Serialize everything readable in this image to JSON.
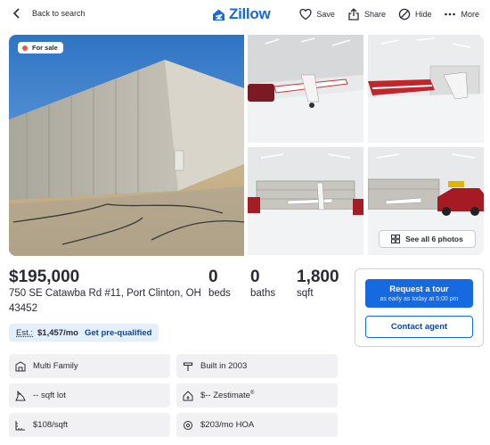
{
  "header": {
    "back_label": "Back to search",
    "logo_text": "Zillow",
    "actions": [
      {
        "label": "Save",
        "icon": "heart-icon"
      },
      {
        "label": "Share",
        "icon": "share-icon"
      },
      {
        "label": "Hide",
        "icon": "hide-icon"
      },
      {
        "label": "More",
        "icon": "more-icon"
      }
    ]
  },
  "gallery": {
    "status_badge": "For sale",
    "see_all_label": "See all 6 photos"
  },
  "listing": {
    "price": "$195,000",
    "address": "750 SE Catawba Rd #11, Port Clinton, OH 43452",
    "beds": "0",
    "beds_label": "beds",
    "baths": "0",
    "baths_label": "baths",
    "sqft": "1,800",
    "sqft_label": "sqft"
  },
  "estimate": {
    "label": "Est.:",
    "amount": "$1,457/mo",
    "prequal_label": "Get pre-qualified"
  },
  "cta": {
    "tour_label": "Request a tour",
    "tour_sub": "as early as today at 5:00 pm",
    "agent_label": "Contact agent"
  },
  "facts": {
    "type": "Multi Family",
    "built": "Built in 2003",
    "lot": "-- sqft lot",
    "zestimate": "$-- Zestimate",
    "zestimate_mark": "®",
    "price_per_sqft": "$108/sqft",
    "hoa": "$203/mo HOA"
  },
  "colors": {
    "brand": "#1769e0",
    "badge_dot": "#e8574e",
    "estimate_bg": "#e3f0fb"
  }
}
